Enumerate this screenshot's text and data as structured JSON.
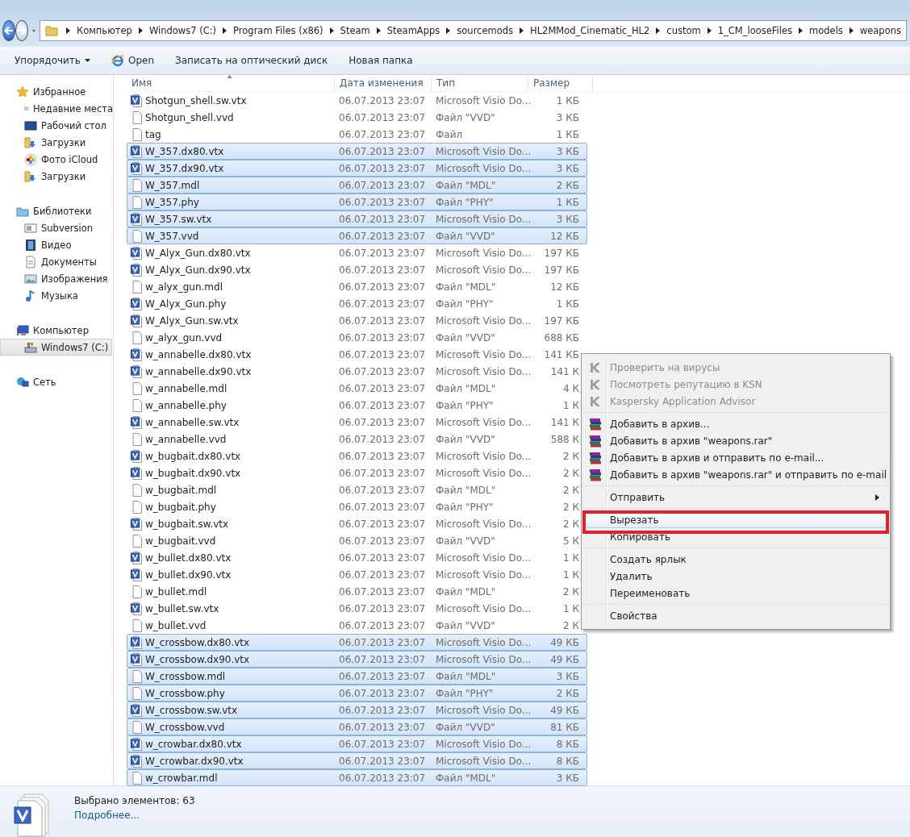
{
  "address_bar": {
    "segments": [
      "Компьютер",
      "Windows7 (C:)",
      "Program Files (x86)",
      "Steam",
      "SteamApps",
      "sourcemods",
      "HL2MMod_Cinematic_HL2",
      "custom",
      "1_CM_looseFiles",
      "models",
      "weapons"
    ]
  },
  "toolbar": {
    "buttons": [
      {
        "label": "Упорядочить",
        "kind": "dropdown"
      },
      {
        "label": "Open",
        "kind": "browser"
      },
      {
        "label": "Записать на оптический диск",
        "kind": "plain"
      },
      {
        "label": "Новая папка",
        "kind": "plain"
      }
    ]
  },
  "sidebar": {
    "groups": [
      {
        "label": "Избранное",
        "items": [
          {
            "label": "Недавние места",
            "selected": false
          },
          {
            "label": "Рабочий стол",
            "selected": false
          },
          {
            "label": "Загрузки",
            "selected": false
          },
          {
            "label": "Фото iCloud",
            "selected": false
          },
          {
            "label": "Загрузки",
            "selected": false
          }
        ]
      },
      {
        "label": "Библиотеки",
        "items": [
          {
            "label": "Subversion",
            "selected": false
          },
          {
            "label": "Видео",
            "selected": false
          },
          {
            "label": "Документы",
            "selected": false
          },
          {
            "label": "Изображения",
            "selected": false
          },
          {
            "label": "Музыка",
            "selected": false
          }
        ]
      },
      {
        "label": "Компьютер",
        "items": [
          {
            "label": "Windows7 (C:)",
            "selected": true
          }
        ]
      },
      {
        "label": "Сеть"
      }
    ]
  },
  "file_list": {
    "columns": [
      "Имя",
      "Дата изменения",
      "Тип",
      "Размер"
    ],
    "rows": [
      {
        "name": "Shotgun_shell.sw.vtx",
        "date": "06.07.2013 23:07",
        "type": "Microsoft Visio Do...",
        "size": "1 КБ",
        "kind": "visio",
        "selected": false
      },
      {
        "name": "Shotgun_shell.vvd",
        "date": "06.07.2013 23:07",
        "type": "Файл \"VVD\"",
        "size": "3 КБ",
        "kind": "blank",
        "selected": false
      },
      {
        "name": "tag",
        "date": "06.07.2013 23:07",
        "type": "Файл",
        "size": "1 КБ",
        "kind": "blank",
        "selected": false
      },
      {
        "name": "W_357.dx80.vtx",
        "date": "06.07.2013 23:07",
        "type": "Microsoft Visio Do...",
        "size": "3 КБ",
        "kind": "visio",
        "selected": true
      },
      {
        "name": "W_357.dx90.vtx",
        "date": "06.07.2013 23:07",
        "type": "Microsoft Visio Do...",
        "size": "3 КБ",
        "kind": "visio",
        "selected": true
      },
      {
        "name": "W_357.mdl",
        "date": "06.07.2013 23:07",
        "type": "Файл \"MDL\"",
        "size": "2 КБ",
        "kind": "blank",
        "selected": true
      },
      {
        "name": "W_357.phy",
        "date": "06.07.2013 23:07",
        "type": "Файл \"PHY\"",
        "size": "1 КБ",
        "kind": "blank",
        "selected": true
      },
      {
        "name": "W_357.sw.vtx",
        "date": "06.07.2013 23:07",
        "type": "Microsoft Visio Do...",
        "size": "3 КБ",
        "kind": "visio",
        "selected": true
      },
      {
        "name": "W_357.vvd",
        "date": "06.07.2013 23:07",
        "type": "Файл \"VVD\"",
        "size": "12 КБ",
        "kind": "blank",
        "selected": true
      },
      {
        "name": "W_Alyx_Gun.dx80.vtx",
        "date": "06.07.2013 23:07",
        "type": "Microsoft Visio Do...",
        "size": "197 КБ",
        "kind": "visio",
        "selected": false
      },
      {
        "name": "W_Alyx_Gun.dx90.vtx",
        "date": "06.07.2013 23:07",
        "type": "Microsoft Visio Do...",
        "size": "197 КБ",
        "kind": "visio",
        "selected": false
      },
      {
        "name": "w_alyx_gun.mdl",
        "date": "06.07.2013 23:07",
        "type": "Файл \"MDL\"",
        "size": "12 КБ",
        "kind": "blank",
        "selected": false
      },
      {
        "name": "W_Alyx_Gun.phy",
        "date": "06.07.2013 23:07",
        "type": "Файл \"PHY\"",
        "size": "1 КБ",
        "kind": "visio",
        "selected": false
      },
      {
        "name": "W_Alyx_Gun.sw.vtx",
        "date": "06.07.2013 23:07",
        "type": "Microsoft Visio Do...",
        "size": "197 КБ",
        "kind": "visio",
        "selected": false
      },
      {
        "name": "w_alyx_gun.vvd",
        "date": "06.07.2013 23:07",
        "type": "Файл \"VVD\"",
        "size": "688 КБ",
        "kind": "blank",
        "selected": false
      },
      {
        "name": "w_annabelle.dx80.vtx",
        "date": "06.07.2013 23:07",
        "type": "Microsoft Visio Do...",
        "size": "141 КБ",
        "kind": "visio",
        "selected": false
      },
      {
        "name": "w_annabelle.dx90.vtx",
        "date": "06.07.2013 23:07",
        "type": "Microsoft Visio Do...",
        "size": "141 К",
        "kind": "visio",
        "selected": false
      },
      {
        "name": "w_annabelle.mdl",
        "date": "06.07.2013 23:07",
        "type": "Файл \"MDL\"",
        "size": "4 К",
        "kind": "blank",
        "selected": false
      },
      {
        "name": "w_annabelle.phy",
        "date": "06.07.2013 23:07",
        "type": "Файл \"PHY\"",
        "size": "1 К",
        "kind": "blank",
        "selected": false
      },
      {
        "name": "w_annabelle.sw.vtx",
        "date": "06.07.2013 23:07",
        "type": "Microsoft Visio Do...",
        "size": "141 К",
        "kind": "visio",
        "selected": false
      },
      {
        "name": "w_annabelle.vvd",
        "date": "06.07.2013 23:07",
        "type": "Файл \"VVD\"",
        "size": "588 К",
        "kind": "blank",
        "selected": false
      },
      {
        "name": "w_bugbait.dx80.vtx",
        "date": "06.07.2013 23:07",
        "type": "Microsoft Visio Do...",
        "size": "2 К",
        "kind": "visio",
        "selected": false
      },
      {
        "name": "w_bugbait.dx90.vtx",
        "date": "06.07.2013 23:07",
        "type": "Microsoft Visio Do...",
        "size": "2 К",
        "kind": "visio",
        "selected": false
      },
      {
        "name": "w_bugbait.mdl",
        "date": "06.07.2013 23:07",
        "type": "Файл \"MDL\"",
        "size": "2 К",
        "kind": "blank",
        "selected": false
      },
      {
        "name": "w_bugbait.phy",
        "date": "06.07.2013 23:07",
        "type": "Файл \"PHY\"",
        "size": "2 К",
        "kind": "blank",
        "selected": false
      },
      {
        "name": "w_bugbait.sw.vtx",
        "date": "06.07.2013 23:07",
        "type": "Microsoft Visio Do...",
        "size": "2 К",
        "kind": "visio",
        "selected": false
      },
      {
        "name": "w_bugbait.vvd",
        "date": "06.07.2013 23:07",
        "type": "Файл \"VVD\"",
        "size": "5 К",
        "kind": "blank",
        "selected": false
      },
      {
        "name": "w_bullet.dx80.vtx",
        "date": "06.07.2013 23:07",
        "type": "Microsoft Visio Do...",
        "size": "1 К",
        "kind": "visio",
        "selected": false
      },
      {
        "name": "w_bullet.dx90.vtx",
        "date": "06.07.2013 23:07",
        "type": "Microsoft Visio Do...",
        "size": "1 К",
        "kind": "visio",
        "selected": false
      },
      {
        "name": "w_bullet.mdl",
        "date": "06.07.2013 23:07",
        "type": "Файл \"MDL\"",
        "size": "2 К",
        "kind": "blank",
        "selected": false
      },
      {
        "name": "w_bullet.sw.vtx",
        "date": "06.07.2013 23:07",
        "type": "Microsoft Visio Do...",
        "size": "1 К",
        "kind": "visio",
        "selected": false
      },
      {
        "name": "w_bullet.vvd",
        "date": "06.07.2013 23:07",
        "type": "Файл \"VVD\"",
        "size": "2 К",
        "kind": "blank",
        "selected": false
      },
      {
        "name": "W_crossbow.dx80.vtx",
        "date": "06.07.2013 23:07",
        "type": "Microsoft Visio Do...",
        "size": "49 КБ",
        "kind": "visio",
        "selected": true
      },
      {
        "name": "W_crossbow.dx90.vtx",
        "date": "06.07.2013 23:07",
        "type": "Microsoft Visio Do...",
        "size": "49 КБ",
        "kind": "visio",
        "selected": true
      },
      {
        "name": "W_crossbow.mdl",
        "date": "06.07.2013 23:07",
        "type": "Файл \"MDL\"",
        "size": "3 КБ",
        "kind": "blank",
        "selected": true
      },
      {
        "name": "W_crossbow.phy",
        "date": "06.07.2013 23:07",
        "type": "Файл \"PHY\"",
        "size": "2 КБ",
        "kind": "blank",
        "selected": true
      },
      {
        "name": "W_crossbow.sw.vtx",
        "date": "06.07.2013 23:07",
        "type": "Microsoft Visio Do...",
        "size": "49 КБ",
        "kind": "visio",
        "selected": true
      },
      {
        "name": "W_crossbow.vvd",
        "date": "06.07.2013 23:07",
        "type": "Файл \"VVD\"",
        "size": "81 КБ",
        "kind": "blank",
        "selected": true
      },
      {
        "name": "w_crowbar.dx80.vtx",
        "date": "06.07.2013 23:07",
        "type": "Microsoft Visio Do...",
        "size": "8 КБ",
        "kind": "visio",
        "selected": true
      },
      {
        "name": "W_crowbar.dx90.vtx",
        "date": "06.07.2013 23:07",
        "type": "Microsoft Visio Do...",
        "size": "8 КБ",
        "kind": "visio",
        "selected": true
      },
      {
        "name": "w_crowbar.mdl",
        "date": "06.07.2013 23:07",
        "type": "Файл \"MDL\"",
        "size": "3 КБ",
        "kind": "blank",
        "selected": true
      }
    ]
  },
  "context_menu": {
    "groups": [
      [
        {
          "label": "Проверить на вирусы",
          "kind": "kaspersky",
          "disabled": true,
          "selected": false
        },
        {
          "label": "Посмотреть репутацию в KSN",
          "kind": "kaspersky",
          "disabled": true,
          "selected": false
        },
        {
          "label": "Kaspersky Application Advisor",
          "kind": "kaspersky",
          "disabled": true,
          "selected": false
        }
      ],
      [
        {
          "label": "Добавить в архив...",
          "kind": "archive",
          "disabled": false,
          "selected": false
        },
        {
          "label": "Добавить в архив \"weapons.rar\"",
          "kind": "archive",
          "disabled": false,
          "selected": false
        },
        {
          "label": "Добавить в архив и отправить по e-mail...",
          "kind": "archive",
          "disabled": false,
          "selected": false
        },
        {
          "label": "Добавить в архив \"weapons.rar\" и отправить по e-mail",
          "kind": "archive",
          "disabled": false,
          "selected": false
        }
      ],
      [
        {
          "label": "Отправить",
          "kind": "submenu",
          "disabled": false,
          "selected": false
        }
      ],
      [
        {
          "label": "Вырезать",
          "kind": "plain",
          "disabled": false,
          "selected": true,
          "highlighted": true
        },
        {
          "label": "Копировать",
          "kind": "plain",
          "disabled": false,
          "selected": false,
          "highlighted": false
        }
      ],
      [
        {
          "label": "Создать ярлык",
          "kind": "plain",
          "disabled": false,
          "selected": false
        },
        {
          "label": "Удалить",
          "kind": "plain",
          "disabled": false,
          "selected": false
        },
        {
          "label": "Переименовать",
          "kind": "plain",
          "disabled": false,
          "selected": false
        }
      ],
      [
        {
          "label": "Свойства",
          "kind": "plain",
          "disabled": false,
          "selected": false
        }
      ]
    ]
  },
  "status_bar": {
    "summary": "Выбрано элементов: 63",
    "link": "Подробнее..."
  }
}
